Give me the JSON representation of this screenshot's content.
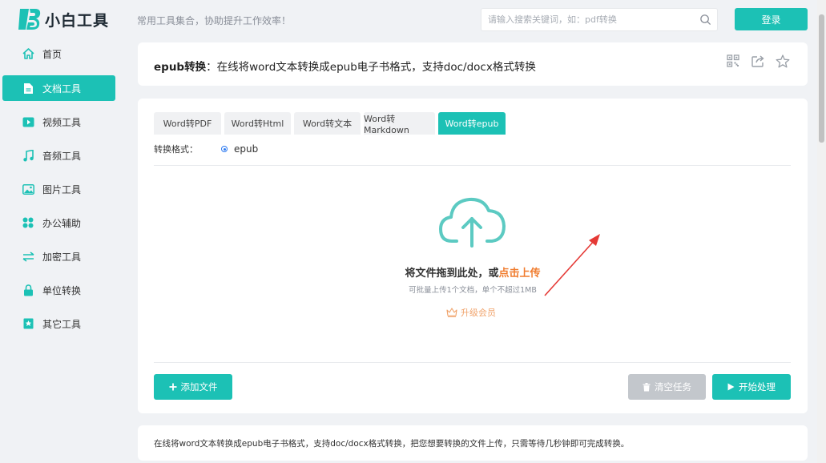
{
  "header": {
    "logo_text": "小白工具",
    "slogan": "常用工具集合，协助提升工作效率！",
    "search_placeholder": "请输入搜索关键词，如：pdf转换",
    "login_label": "登录"
  },
  "sidebar": {
    "items": [
      {
        "label": "首页",
        "icon": "home-icon"
      },
      {
        "label": "文档工具",
        "icon": "document-icon",
        "active": true
      },
      {
        "label": "视频工具",
        "icon": "video-icon"
      },
      {
        "label": "音频工具",
        "icon": "music-icon"
      },
      {
        "label": "图片工具",
        "icon": "image-icon"
      },
      {
        "label": "办公辅助",
        "icon": "office-icon"
      },
      {
        "label": "加密工具",
        "icon": "exchange-icon"
      },
      {
        "label": "单位转换",
        "icon": "lock-icon"
      },
      {
        "label": "其它工具",
        "icon": "bookmark-icon"
      }
    ]
  },
  "title": {
    "bold": "epub转换",
    "rest": "：在线将word文本转换成epub电子书格式，支持doc/docx格式转换"
  },
  "tabs": [
    "Word转PDF",
    "Word转Html",
    "Word转文本",
    "Word转Markdown",
    "Word转epub"
  ],
  "active_tab": 4,
  "format": {
    "label": "转换格式：",
    "option": "epub"
  },
  "upload": {
    "text_main": "将文件拖到此处，或",
    "text_link": "点击上传",
    "sub": "可批量上传1个文档，单个不超过1MB",
    "upgrade": "升级会员"
  },
  "buttons": {
    "add": "添加文件",
    "clear": "清空任务",
    "start": "开始处理"
  },
  "description": "在线将word文本转换成epub电子书格式，支持doc/docx格式转换，把您想要转换的文件上传，只需等待几秒钟即可完成转换。",
  "colors": {
    "accent": "#1cc1b5",
    "upload_link": "#f07c2e",
    "upgrade": "#f0a36b",
    "annotation_arrow": "#e53935"
  }
}
